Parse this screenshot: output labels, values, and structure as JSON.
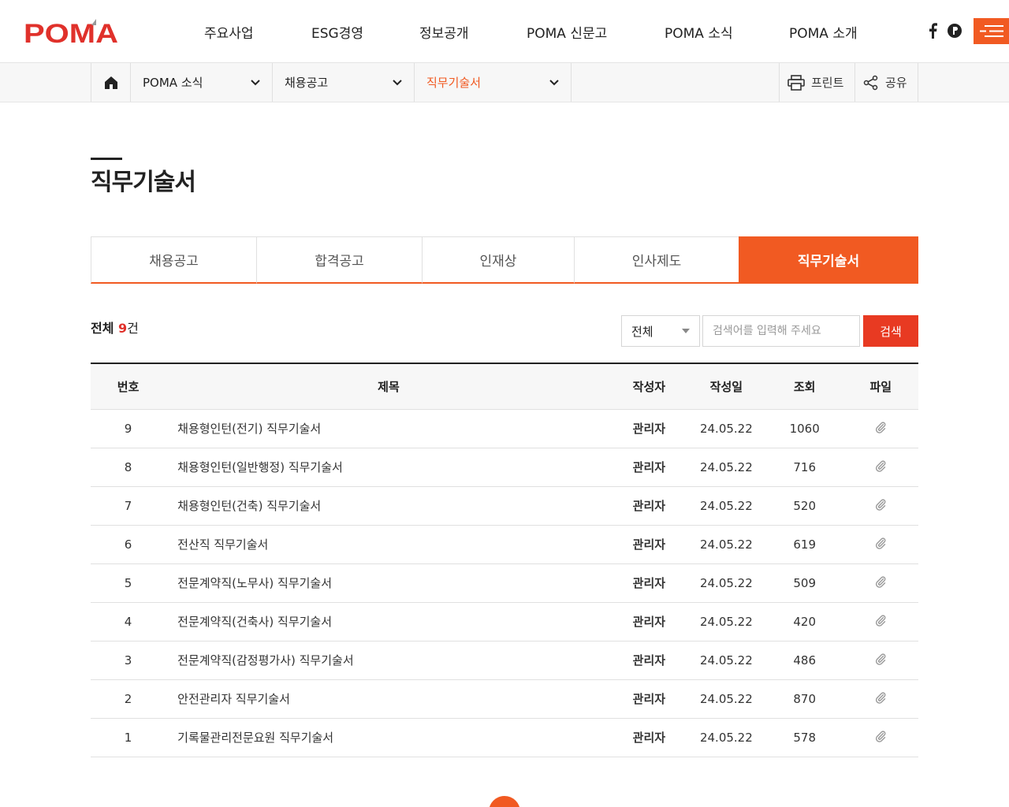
{
  "logo": {
    "text": "POMA",
    "color": "#e0312b"
  },
  "gnb": [
    "주요사업",
    "ESG경영",
    "정보공개",
    "POMA 신문고",
    "POMA 소식",
    "POMA 소개"
  ],
  "sns": {
    "facebook_icon": "facebook-icon",
    "blog_icon": "blog-icon"
  },
  "accent": "#f15a22",
  "location": {
    "depth1": "POMA 소식",
    "depth2": "채용공고",
    "depth3": "직무기술서",
    "print_label": "프린트",
    "share_label": "공유"
  },
  "page_title": "직무기술서",
  "tabs": [
    "채용공고",
    "합격공고",
    "인재상",
    "인사제도",
    "직무기술서"
  ],
  "active_tab": 4,
  "count": {
    "prefix": "전체 ",
    "num": "9",
    "unit": "건"
  },
  "search": {
    "select_value": "전체",
    "placeholder": "검색어를 입력해 주세요",
    "button_label": "검색"
  },
  "table": {
    "headers": [
      "번호",
      "제목",
      "작성자",
      "작성일",
      "조회",
      "파일"
    ],
    "rows": [
      {
        "no": "9",
        "title": "채용형인턴(전기) 직무기술서",
        "writer": "관리자",
        "date": "24.05.22",
        "views": "1060"
      },
      {
        "no": "8",
        "title": "채용형인턴(일반행정) 직무기술서",
        "writer": "관리자",
        "date": "24.05.22",
        "views": "716"
      },
      {
        "no": "7",
        "title": "채용형인턴(건축) 직무기술서",
        "writer": "관리자",
        "date": "24.05.22",
        "views": "520"
      },
      {
        "no": "6",
        "title": "전산직 직무기술서",
        "writer": "관리자",
        "date": "24.05.22",
        "views": "619"
      },
      {
        "no": "5",
        "title": "전문계약직(노무사) 직무기술서",
        "writer": "관리자",
        "date": "24.05.22",
        "views": "509"
      },
      {
        "no": "4",
        "title": "전문계약직(건축사) 직무기술서",
        "writer": "관리자",
        "date": "24.05.22",
        "views": "420"
      },
      {
        "no": "3",
        "title": "전문계약직(감정평가사) 직무기술서",
        "writer": "관리자",
        "date": "24.05.22",
        "views": "486"
      },
      {
        "no": "2",
        "title": "안전관리자 직무기술서",
        "writer": "관리자",
        "date": "24.05.22",
        "views": "870"
      },
      {
        "no": "1",
        "title": "기록물관리전문요원 직무기술서",
        "writer": "관리자",
        "date": "24.05.22",
        "views": "578"
      }
    ]
  }
}
